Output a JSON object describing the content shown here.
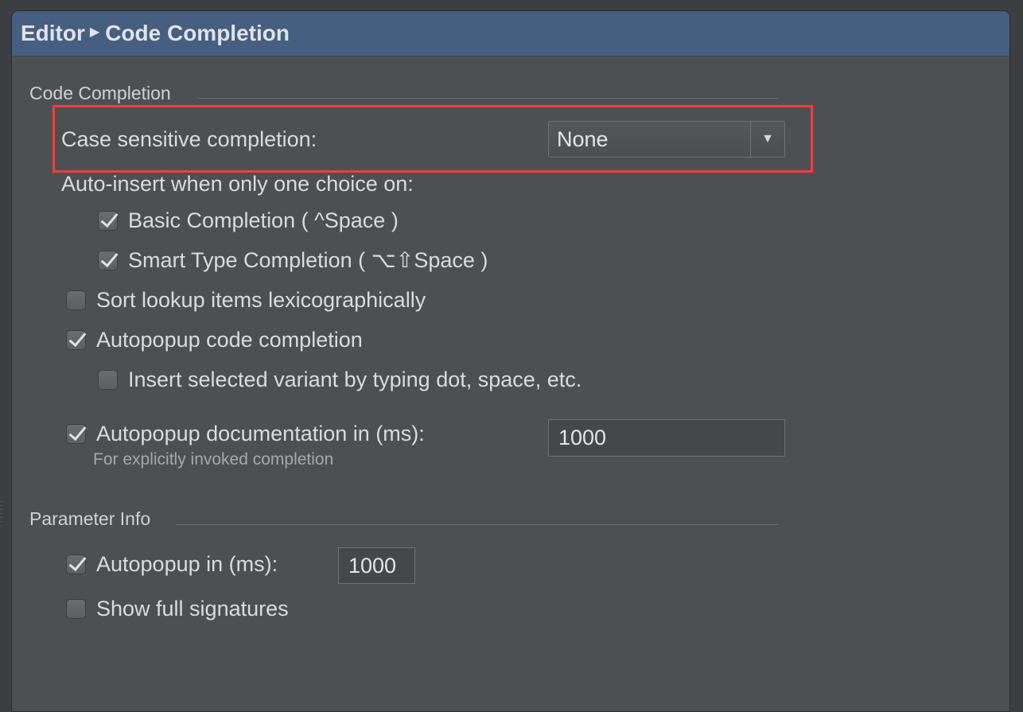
{
  "breadcrumb": {
    "parent": "Editor",
    "current": "Code Completion"
  },
  "code_completion": {
    "group_title": "Code Completion",
    "case_sensitive_label": "Case sensitive completion:",
    "case_sensitive_value": "None",
    "auto_insert_label": "Auto-insert when only one choice on:",
    "basic_completion": {
      "label": "Basic Completion ( ^Space )",
      "checked": true
    },
    "smart_type_completion": {
      "label": "Smart Type Completion ( ⌥⇧Space )",
      "checked": true
    },
    "sort_lookup": {
      "label": "Sort lookup items lexicographically",
      "checked": false
    },
    "autopopup_code": {
      "label": "Autopopup code completion",
      "checked": true
    },
    "insert_selected": {
      "label": "Insert selected variant by typing dot, space, etc.",
      "checked": false
    },
    "autopopup_doc": {
      "label": "Autopopup documentation in (ms):",
      "checked": true,
      "value": "1000"
    },
    "autopopup_doc_hint": "For explicitly invoked completion"
  },
  "parameter_info": {
    "group_title": "Parameter Info",
    "autopopup": {
      "label": "Autopopup in (ms):",
      "checked": true,
      "value": "1000"
    },
    "show_full_signatures": {
      "label": "Show full signatures",
      "checked": false
    }
  },
  "colors": {
    "header_bg": "#465e7f",
    "panel_bg": "#4d5053",
    "highlight_border": "#ee3f3f"
  },
  "icons": {
    "breadcrumb_separator": "triangle-right-icon",
    "dropdown_arrow": "triangle-down-icon",
    "checkbox_check": "check-icon"
  }
}
